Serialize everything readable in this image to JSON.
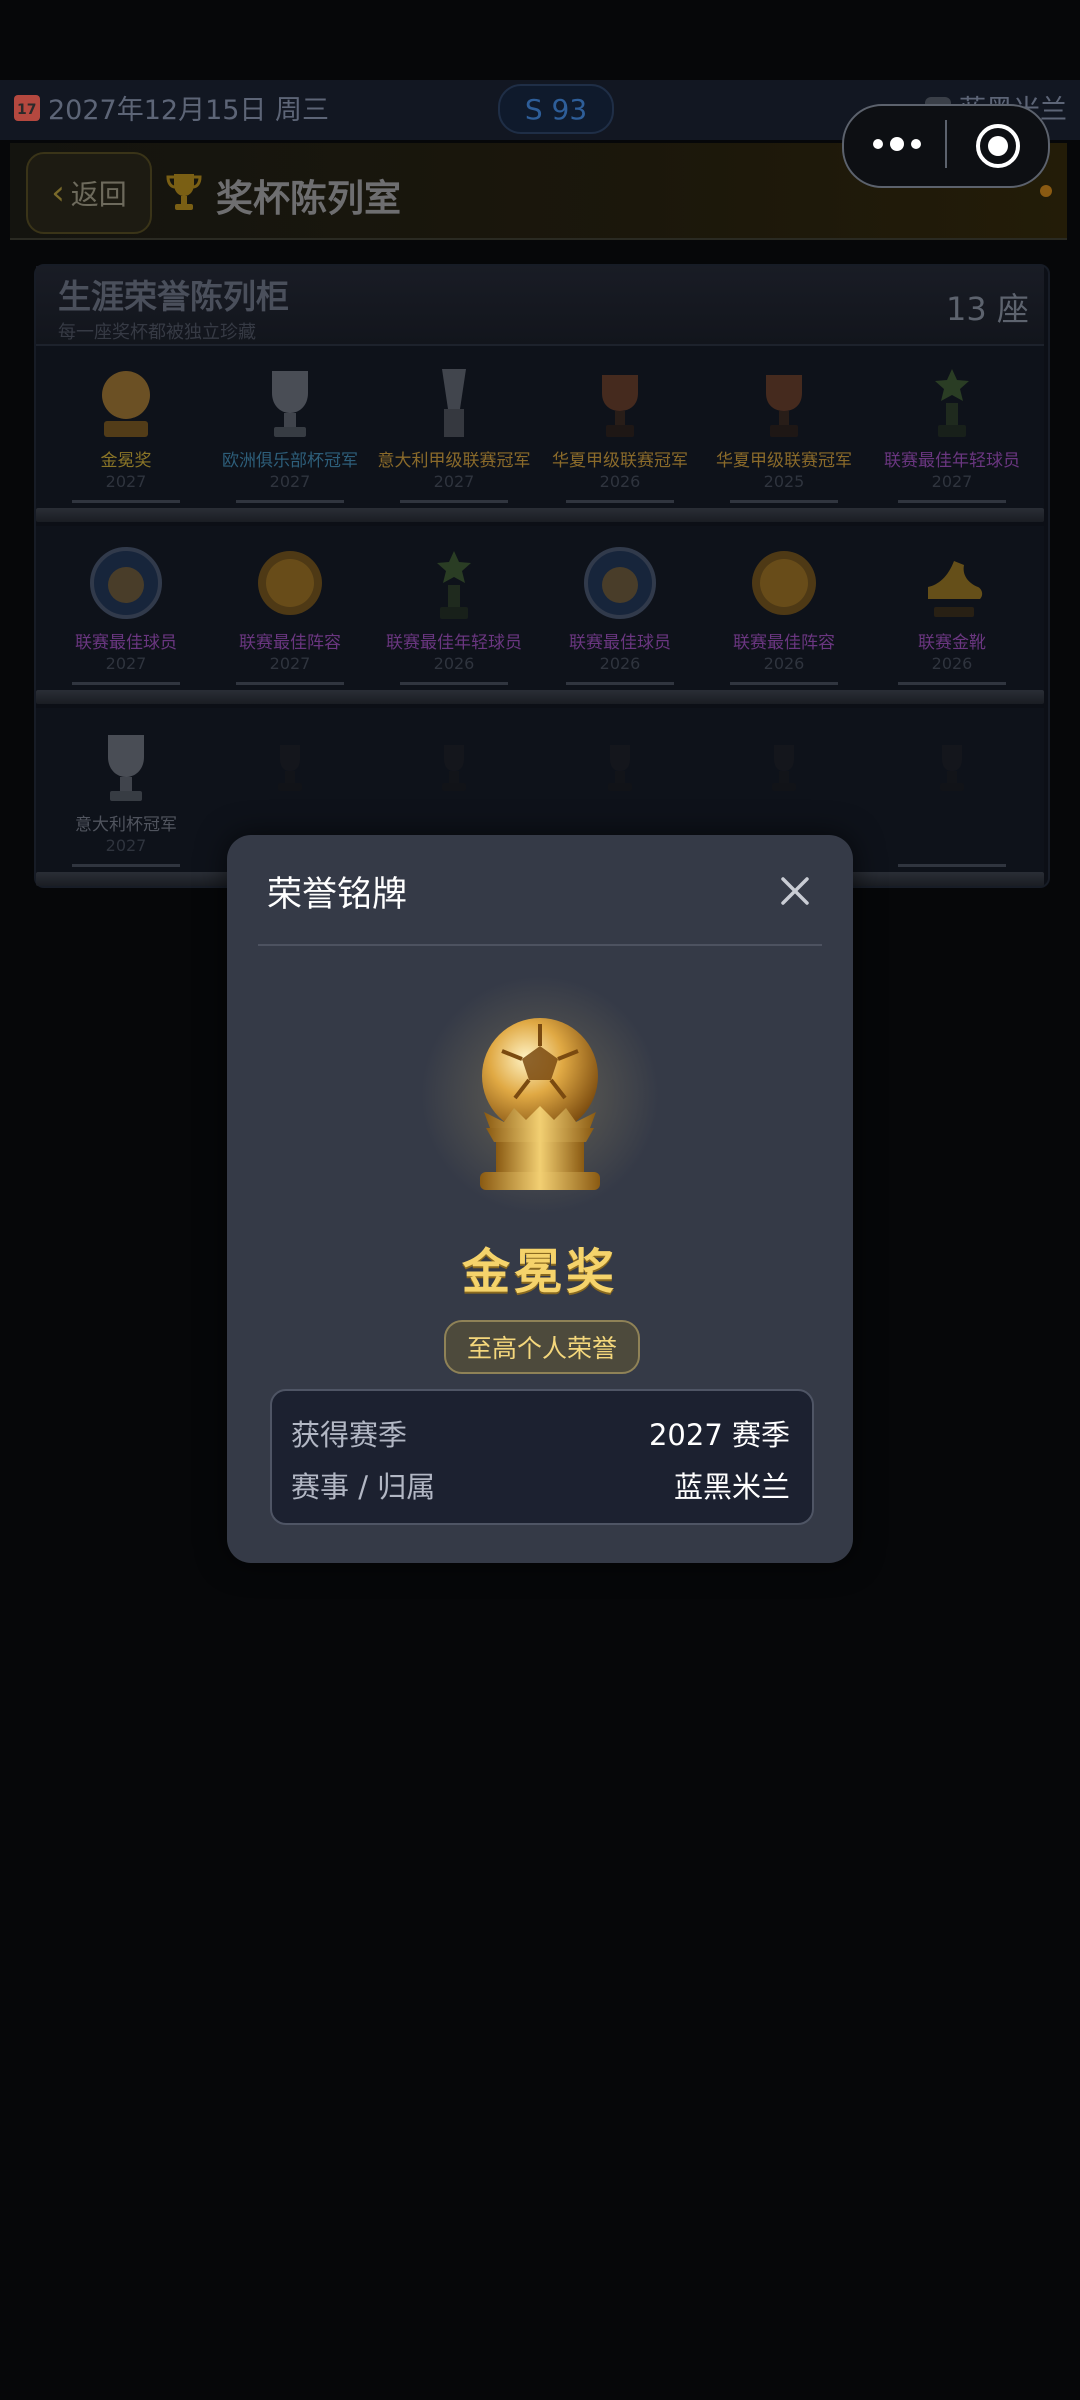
{
  "status": {
    "date": "2027年12月15日 周三",
    "season_pill": "S 93",
    "club": "蓝黑米兰"
  },
  "header": {
    "back_label": "返回",
    "title": "奖杯陈列室"
  },
  "cabinet": {
    "title": "生涯荣誉陈列柜",
    "subtitle": "每一座奖杯都被独立珍藏",
    "count": "13 座",
    "rows": [
      [
        {
          "name": "金冕奖",
          "year": "2027",
          "icon": "golden-ball-trophy-icon",
          "color": "#8a7527"
        },
        {
          "name": "欧洲俱乐部杯冠军",
          "year": "2027",
          "icon": "silver-cup-icon",
          "color": "#2d5e7a"
        },
        {
          "name": "意大利甲级联赛冠军",
          "year": "2027",
          "icon": "silver-league-trophy-icon",
          "color": "#8a6a2a"
        },
        {
          "name": "华夏甲级联赛冠军",
          "year": "2026",
          "icon": "bronze-cup-icon",
          "color": "#8a6a2a"
        },
        {
          "name": "华夏甲级联赛冠军",
          "year": "2025",
          "icon": "bronze-cup-icon",
          "color": "#8a6a2a"
        },
        {
          "name": "联赛最佳年轻球员",
          "year": "2027",
          "icon": "star-trophy-icon",
          "color": "#6a3680"
        }
      ],
      [
        {
          "name": "联赛最佳球员",
          "year": "2027",
          "icon": "player-medal-icon",
          "color": "#6a3680"
        },
        {
          "name": "联赛最佳阵容",
          "year": "2027",
          "icon": "team-medal-icon",
          "color": "#6a3680"
        },
        {
          "name": "联赛最佳年轻球员",
          "year": "2026",
          "icon": "star-trophy-icon",
          "color": "#6a3680"
        },
        {
          "name": "联赛最佳球员",
          "year": "2026",
          "icon": "player-medal-icon",
          "color": "#6a3680"
        },
        {
          "name": "联赛最佳阵容",
          "year": "2026",
          "icon": "team-medal-icon",
          "color": "#6a3680"
        },
        {
          "name": "联赛金靴",
          "year": "2026",
          "icon": "golden-boot-icon",
          "color": "#6a3680"
        }
      ],
      [
        {
          "name": "意大利杯冠军",
          "year": "2027",
          "icon": "silver-cup-icon",
          "color": "#50545e"
        },
        {
          "name": "",
          "year": "",
          "icon": "locked-trophy-icon",
          "color": "#1f2229"
        },
        {
          "name": "",
          "year": "",
          "icon": "locked-trophy-icon",
          "color": "#1f2229"
        },
        {
          "name": "",
          "year": "",
          "icon": "locked-trophy-icon",
          "color": "#1f2229"
        },
        {
          "name": "",
          "year": "",
          "icon": "locked-trophy-icon",
          "color": "#1f2229"
        },
        {
          "name": "",
          "year": "",
          "icon": "locked-trophy-icon",
          "color": "#1f2229"
        }
      ]
    ]
  },
  "modal": {
    "title": "荣誉铭牌",
    "award_name": "金冕奖",
    "badge": "至高个人荣誉",
    "rows": [
      {
        "label": "获得赛季",
        "value": "2027 赛季"
      },
      {
        "label": "赛事 / 归属",
        "value": "蓝黑米兰"
      }
    ]
  },
  "colors": {
    "background": "#060709",
    "modal_bg": "#353a47",
    "award_gold": "#f5d36b",
    "badge_border": "#8f8257"
  }
}
